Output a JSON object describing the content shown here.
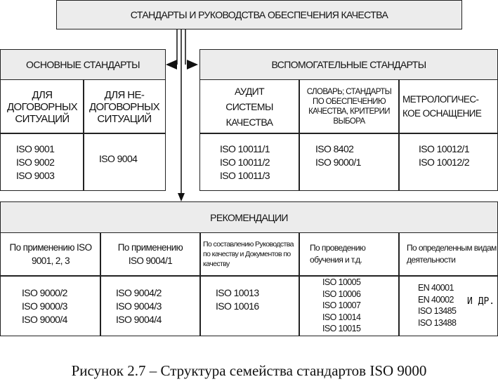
{
  "top": {
    "title": "СТАНДАРТЫ И РУКОВОДСТВА ОБЕСПЕЧЕНИЯ КАЧЕСТВА"
  },
  "main": {
    "title": "ОСНОВНЫЕ СТАНДАРТЫ",
    "cols": [
      {
        "label": "ДЛЯ ДОГОВОРНЫХ СИТУАЦИЙ",
        "items": [
          "ISO 9001",
          "ISO 9002",
          "ISO 9003"
        ]
      },
      {
        "label": "ДЛЯ НЕ-ДОГОВОРНЫХ СИТУАЦИЙ",
        "items": [
          "ISO 9004"
        ]
      }
    ]
  },
  "aux": {
    "title": "ВСПОМОГАТЕЛЬНЫЕ СТАНДАРТЫ",
    "cols": [
      {
        "label": "АУДИТ СИСТЕМЫ КАЧЕСТВА",
        "items": [
          "ISO 10011/1",
          "ISO 10011/2",
          "ISO 10011/3"
        ]
      },
      {
        "label": "СЛОВАРЬ; СТАНДАРТЫ ПО ОБЕСПЕЧЕНИЮ КАЧЕСТВА, КРИТЕРИИ ВЫБОРА",
        "items": [
          "ISO 8402",
          "ISO 9000/1"
        ]
      },
      {
        "label": "МЕТРОЛОГИЧЕС-КОЕ ОСНАЩЕНИЕ",
        "items": [
          "ISO 10012/1",
          "ISO 10012/2"
        ]
      }
    ]
  },
  "rec": {
    "title": "РЕКОМЕНДАЦИИ",
    "cols": [
      {
        "label": "По применению ISO 9001, 2, 3",
        "items": [
          "ISO 9000/2",
          "ISO 9000/3",
          "ISO 9000/4"
        ]
      },
      {
        "label": "По применению ISO 9004/1",
        "items": [
          "ISO 9004/2",
          "ISO 9004/3",
          "ISO 9004/4"
        ]
      },
      {
        "label": "По составлению Руководства по качеству и Документов по качеству",
        "items": [
          "ISO 10013",
          "ISO 10016"
        ]
      },
      {
        "label": "По проведению обучения и т.д.",
        "items": [
          "ISO 10005",
          "ISO 10006",
          "ISO 10007",
          "ISO 10014",
          "ISO 10015"
        ]
      },
      {
        "label": "По определенным видам деятельности",
        "items": [
          "EN 40001",
          "EN 40002",
          "ISO 13485",
          "ISO 13488"
        ],
        "note": "и др."
      }
    ]
  },
  "caption": "Рисунок 2.7 – Структура семейства стандартов ISO 9000"
}
